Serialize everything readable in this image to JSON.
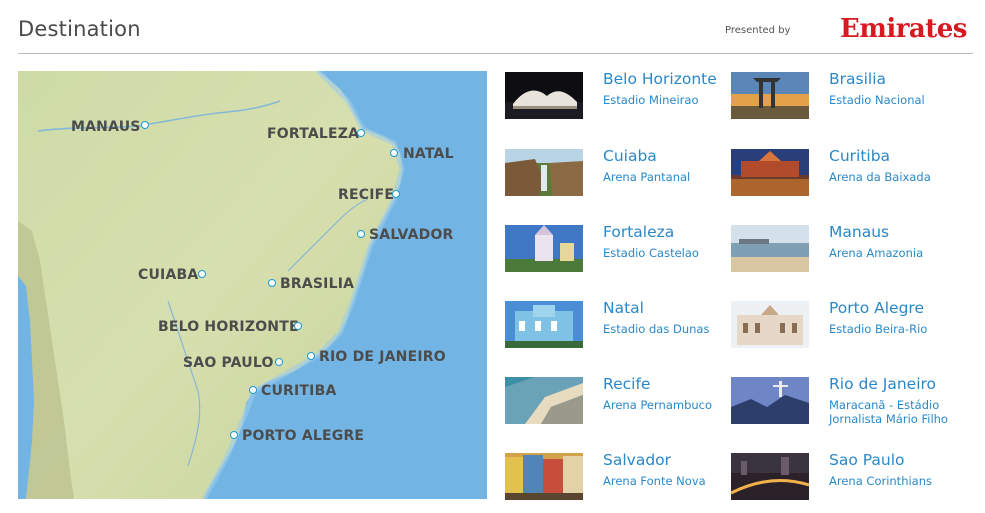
{
  "header": {
    "title": "Destination",
    "presented_by": "Presented by",
    "brand": "Emirates",
    "brand_color": "#d71921"
  },
  "map": {
    "cities": [
      {
        "label": "MANAUS"
      },
      {
        "label": "FORTALEZA"
      },
      {
        "label": "NATAL"
      },
      {
        "label": "RECIFE"
      },
      {
        "label": "SALVADOR"
      },
      {
        "label": "CUIABA"
      },
      {
        "label": "BRASILIA"
      },
      {
        "label": "BELO HORIZONTE"
      },
      {
        "label": "SAO PAULO"
      },
      {
        "label": "RIO DE JANEIRO"
      },
      {
        "label": "CURITIBA"
      },
      {
        "label": "PORTO ALEGRE"
      }
    ],
    "ocean_color": "#72b5e5",
    "land_color": "#c9d9a3",
    "marker_color": "#1a9bd7"
  },
  "destinations": [
    {
      "city": "Belo Horizonte",
      "stadium": "Estadio Mineirao"
    },
    {
      "city": "Brasilia",
      "stadium": "Estadio Nacional"
    },
    {
      "city": "Cuiaba",
      "stadium": "Arena Pantanal"
    },
    {
      "city": "Curitiba",
      "stadium": "Arena da Baixada"
    },
    {
      "city": "Fortaleza",
      "stadium": "Estadio Castelao"
    },
    {
      "city": "Manaus",
      "stadium": "Arena Amazonia"
    },
    {
      "city": "Natal",
      "stadium": "Estadio das Dunas"
    },
    {
      "city": "Porto Alegre",
      "stadium": "Estadio Beira-Rio"
    },
    {
      "city": "Recife",
      "stadium": "Arena Pernambuco"
    },
    {
      "city": "Rio de Janeiro",
      "stadium": "Maracanã - Estádio Jornalista Mário Filho"
    },
    {
      "city": "Salvador",
      "stadium": "Arena Fonte Nova"
    },
    {
      "city": "Sao Paulo",
      "stadium": "Arena Corinthians"
    }
  ],
  "link_color": "#2a88c9"
}
